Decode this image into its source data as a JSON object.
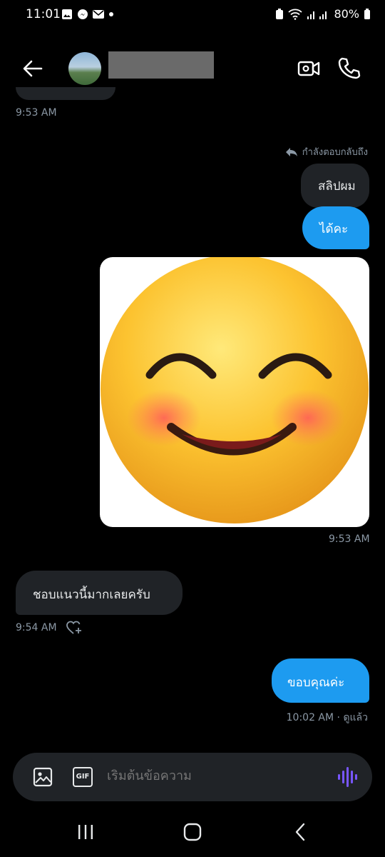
{
  "status": {
    "time": "11:01",
    "battery": "80%"
  },
  "header": {
    "back_icon": "arrow-left-icon",
    "video_icon": "video-call-icon",
    "call_icon": "phone-icon"
  },
  "messages": {
    "prev_time": "9:53 AM",
    "reply_label": "กำลังตอบกลับถึง",
    "quoted_text": "สลิปผม",
    "me1_text": "ได้คะ",
    "image_time": "9:53 AM",
    "them1_text": "ชอบแนวนี้มากเลยครับ",
    "them1_time": "9:54 AM",
    "me2_text": "ขอบคุณค่ะ",
    "me2_status": "10:02 AM · ดูแล้ว"
  },
  "composer": {
    "placeholder": "เริ่มต้นข้อความ",
    "gif_label": "GIF",
    "accent": "#7856ff"
  },
  "colors": {
    "accent": "#1d9bf0",
    "bubble_them": "#202327",
    "background": "#000000"
  }
}
